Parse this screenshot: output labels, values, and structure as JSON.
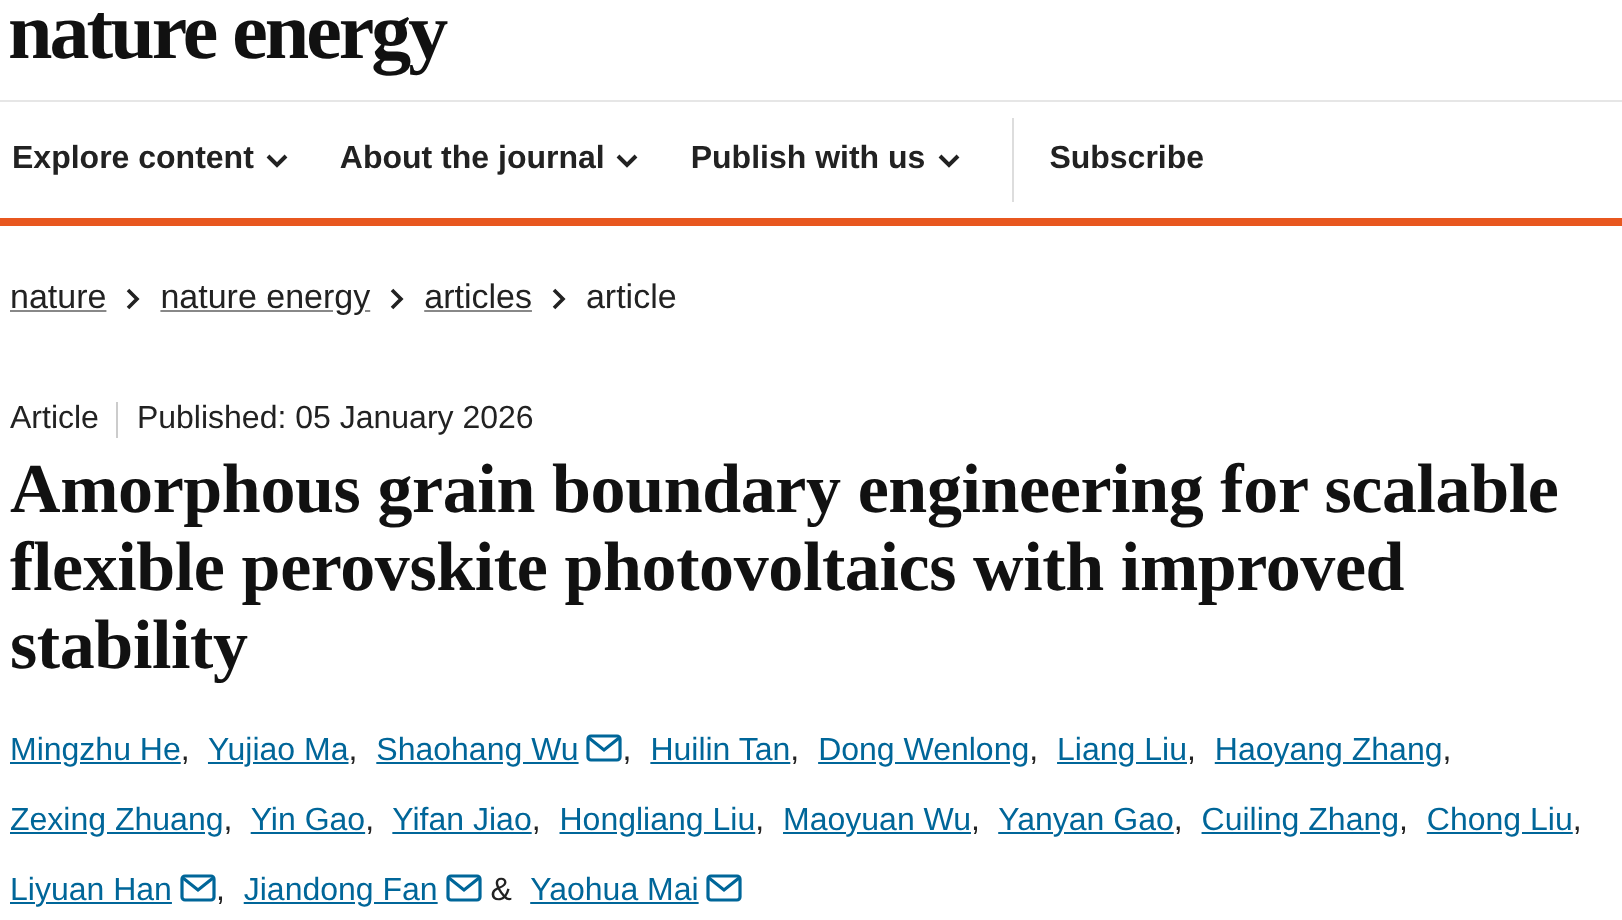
{
  "logo": "nature energy",
  "nav": [
    {
      "label": "Explore content",
      "dropdown": true
    },
    {
      "label": "About the journal",
      "dropdown": true
    },
    {
      "label": "Publish with us",
      "dropdown": true
    },
    {
      "label": "Subscribe",
      "dropdown": false
    }
  ],
  "breadcrumbs": [
    {
      "label": "nature",
      "link": true
    },
    {
      "label": "nature energy",
      "link": true
    },
    {
      "label": "articles",
      "link": true
    },
    {
      "label": "article",
      "link": false
    }
  ],
  "article_type": "Article",
  "published": "Published: 05 January 2026",
  "title": "Amorphous grain boundary engineering for scalable flexible perovskite photovoltaics with improved stability",
  "authors": [
    {
      "name": "Mingzhu He",
      "email": false,
      "punct": ","
    },
    {
      "name": "Yujiao Ma",
      "email": false,
      "punct": ","
    },
    {
      "name": "Shaohang Wu",
      "email": true,
      "punct": ","
    },
    {
      "name": "Huilin Tan",
      "email": false,
      "punct": ","
    },
    {
      "name": "Dong Wenlong",
      "email": false,
      "punct": ","
    },
    {
      "name": "Liang Liu",
      "email": false,
      "punct": ","
    },
    {
      "name": "Haoyang Zhang",
      "email": false,
      "punct": ","
    },
    {
      "name": "Zexing Zhuang",
      "email": false,
      "punct": ","
    },
    {
      "name": "Yin Gao",
      "email": false,
      "punct": ","
    },
    {
      "name": "Yifan Jiao",
      "email": false,
      "punct": ","
    },
    {
      "name": "Hongliang Liu",
      "email": false,
      "punct": ","
    },
    {
      "name": "Maoyuan Wu",
      "email": false,
      "punct": ","
    },
    {
      "name": "Yanyan Gao",
      "email": false,
      "punct": ","
    },
    {
      "name": "Cuiling Zhang",
      "email": false,
      "punct": ","
    },
    {
      "name": "Chong Liu",
      "email": false,
      "punct": ","
    },
    {
      "name": "Liyuan Han",
      "email": true,
      "punct": ","
    },
    {
      "name": "Jiandong Fan",
      "email": true,
      "punct": "&"
    },
    {
      "name": "Yaohua Mai",
      "email": true
    }
  ]
}
